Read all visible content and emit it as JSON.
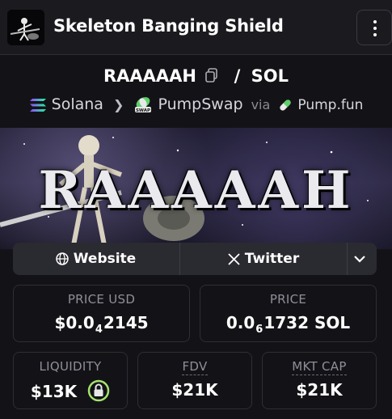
{
  "header": {
    "title": "Skeleton Banging Shield",
    "menu_icon": "dots-vertical-icon"
  },
  "pair": {
    "base": "RAAAAAH",
    "separator": "/",
    "quote": "SOL"
  },
  "chain": {
    "network": "Solana",
    "dex": "PumpSwap",
    "dex_badge": "SWAP",
    "via_label": "via",
    "launchpad": "Pump.fun"
  },
  "banner": {
    "text": "RAAAAAH"
  },
  "links": {
    "website": "Website",
    "twitter": "Twitter"
  },
  "stats": {
    "price_usd": {
      "label": "PRICE USD",
      "prefix": "$0.0",
      "zeros": "4",
      "rest": "2145"
    },
    "price_native": {
      "label": "PRICE",
      "prefix": "0.0",
      "zeros": "6",
      "rest": "1732 SOL"
    },
    "liquidity": {
      "label": "LIQUIDITY",
      "value": "$13K"
    },
    "fdv": {
      "label": "FDV",
      "value": "$21K"
    },
    "mkt_cap": {
      "label": "MKT CAP",
      "value": "$21K"
    }
  },
  "colors": {
    "background": "#131317",
    "card_border": "#2d2d33",
    "label": "#8e8e98",
    "lock_green": "#a6e36e",
    "solana_gradient": [
      "#9945ff",
      "#19fb9b"
    ]
  }
}
